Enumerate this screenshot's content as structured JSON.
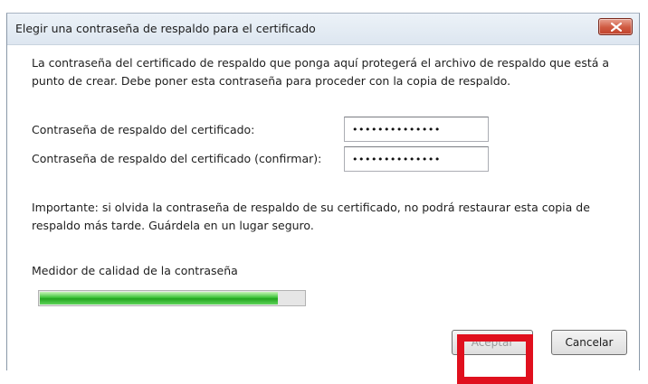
{
  "dialog": {
    "title": "Elegir una contraseña de respaldo para el certificado",
    "close_icon": "close-icon",
    "intro": "La contraseña del certificado de respaldo que ponga aquí protegerá el archivo de respaldo que está a punto de crear. Debe poner esta contraseña para proceder con la copia de respaldo.",
    "password_label": "Contraseña de respaldo del certificado:",
    "password_value": "••••••••••••••",
    "confirm_label": "Contraseña de respaldo del certificado (confirmar):",
    "confirm_value": "••••••••••••••",
    "important_note": "Importante: si olvida la contraseña de respaldo de su certificado, no podrá restaurar esta copia de respaldo más tarde. Guárdela en un lugar seguro.",
    "meter_label": "Medidor de calidad de la contraseña",
    "meter_level": 0.9,
    "meter_color": "#3ec43a",
    "ok_label": "Aceptar",
    "cancel_label": "Cancelar",
    "highlight_color": "#e0101e"
  }
}
